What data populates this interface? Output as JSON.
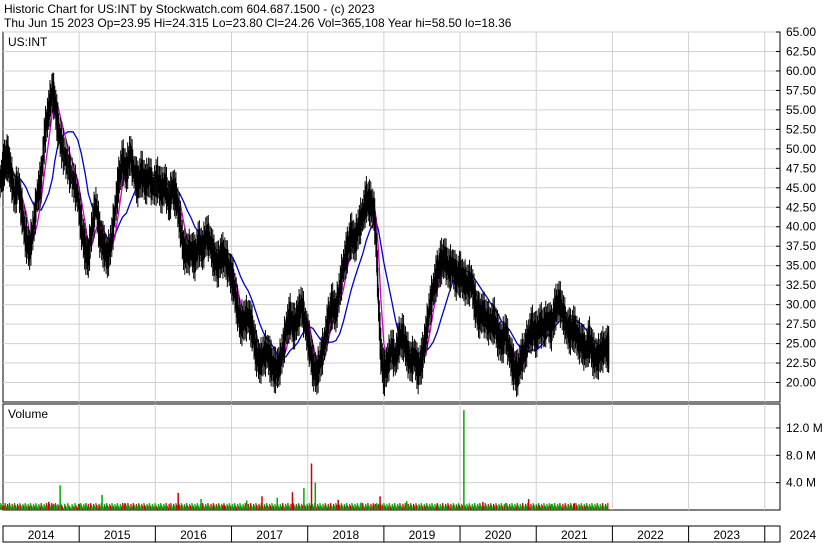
{
  "header": {
    "line1": "Historic Chart for US:INT by Stockwatch.com 604.687.1500 - (c) 2023",
    "line2": "Thu Jun 15 2023   Op=23.95   Hi=24.315   Lo=23.80   Cl=24.26   Vol=365,108   Year hi=58.50   lo=18.36"
  },
  "chart_data": {
    "type": "line",
    "symbol_label": "US:INT",
    "volume_label": "Volume",
    "x_ticks": [
      "2014",
      "2015",
      "2016",
      "2017",
      "2018",
      "2019",
      "2020",
      "2021",
      "2022",
      "2023",
      "2024"
    ],
    "x_range": [
      2014,
      2024.2
    ],
    "price_ticks": [
      "65.00",
      "62.50",
      "60.00",
      "57.50",
      "55.00",
      "52.50",
      "50.00",
      "47.50",
      "45.00",
      "42.50",
      "40.00",
      "37.50",
      "35.00",
      "32.50",
      "30.00",
      "27.50",
      "25.00",
      "22.50",
      "20.00"
    ],
    "price_range": [
      17.5,
      65.0
    ],
    "volume_ticks": [
      "12.0 M",
      "8.0 M",
      "4.0 M"
    ],
    "volume_range": [
      0,
      15.5
    ],
    "grid": true,
    "colors": {
      "price": "#000000",
      "ma_short": "#cc00cc",
      "ma_long": "#0000cc",
      "volume_up": "#00aa00",
      "volume_down": "#cc0000"
    },
    "price_series": [
      {
        "x": 2013.93,
        "y": 44.5
      },
      {
        "x": 2013.98,
        "y": 46.5
      },
      {
        "x": 2014.02,
        "y": 48.2
      },
      {
        "x": 2014.06,
        "y": 49.0
      },
      {
        "x": 2014.1,
        "y": 47.0
      },
      {
        "x": 2014.15,
        "y": 44.0
      },
      {
        "x": 2014.2,
        "y": 45.5
      },
      {
        "x": 2014.25,
        "y": 42.0
      },
      {
        "x": 2014.3,
        "y": 38.5
      },
      {
        "x": 2014.35,
        "y": 37.0
      },
      {
        "x": 2014.4,
        "y": 40.0
      },
      {
        "x": 2014.45,
        "y": 44.0
      },
      {
        "x": 2014.5,
        "y": 46.0
      },
      {
        "x": 2014.55,
        "y": 52.0
      },
      {
        "x": 2014.6,
        "y": 55.0
      },
      {
        "x": 2014.65,
        "y": 57.5
      },
      {
        "x": 2014.68,
        "y": 56.0
      },
      {
        "x": 2014.72,
        "y": 53.0
      },
      {
        "x": 2014.78,
        "y": 50.0
      },
      {
        "x": 2014.85,
        "y": 48.0
      },
      {
        "x": 2014.92,
        "y": 46.0
      },
      {
        "x": 2014.98,
        "y": 44.0
      },
      {
        "x": 2015.03,
        "y": 40.0
      },
      {
        "x": 2015.08,
        "y": 37.0
      },
      {
        "x": 2015.12,
        "y": 36.0
      },
      {
        "x": 2015.17,
        "y": 40.0
      },
      {
        "x": 2015.22,
        "y": 43.0
      },
      {
        "x": 2015.27,
        "y": 39.0
      },
      {
        "x": 2015.32,
        "y": 37.5
      },
      {
        "x": 2015.37,
        "y": 36.0
      },
      {
        "x": 2015.42,
        "y": 38.0
      },
      {
        "x": 2015.47,
        "y": 42.0
      },
      {
        "x": 2015.52,
        "y": 46.0
      },
      {
        "x": 2015.57,
        "y": 48.5
      },
      {
        "x": 2015.62,
        "y": 47.0
      },
      {
        "x": 2015.67,
        "y": 49.5
      },
      {
        "x": 2015.72,
        "y": 47.0
      },
      {
        "x": 2015.77,
        "y": 45.5
      },
      {
        "x": 2015.82,
        "y": 47.0
      },
      {
        "x": 2015.87,
        "y": 45.5
      },
      {
        "x": 2015.92,
        "y": 46.5
      },
      {
        "x": 2015.97,
        "y": 45.0
      },
      {
        "x": 2016.03,
        "y": 46.0
      },
      {
        "x": 2016.08,
        "y": 44.5
      },
      {
        "x": 2016.13,
        "y": 45.5
      },
      {
        "x": 2016.18,
        "y": 43.0
      },
      {
        "x": 2016.22,
        "y": 45.0
      },
      {
        "x": 2016.27,
        "y": 44.0
      },
      {
        "x": 2016.32,
        "y": 41.0
      },
      {
        "x": 2016.37,
        "y": 37.0
      },
      {
        "x": 2016.42,
        "y": 36.5
      },
      {
        "x": 2016.47,
        "y": 37.0
      },
      {
        "x": 2016.52,
        "y": 36.0
      },
      {
        "x": 2016.57,
        "y": 38.0
      },
      {
        "x": 2016.62,
        "y": 37.0
      },
      {
        "x": 2016.67,
        "y": 39.0
      },
      {
        "x": 2016.72,
        "y": 38.0
      },
      {
        "x": 2016.77,
        "y": 36.0
      },
      {
        "x": 2016.82,
        "y": 35.0
      },
      {
        "x": 2016.87,
        "y": 36.5
      },
      {
        "x": 2016.92,
        "y": 36.0
      },
      {
        "x": 2016.97,
        "y": 34.5
      },
      {
        "x": 2017.02,
        "y": 33.0
      },
      {
        "x": 2017.07,
        "y": 30.0
      },
      {
        "x": 2017.12,
        "y": 27.5
      },
      {
        "x": 2017.17,
        "y": 28.0
      },
      {
        "x": 2017.22,
        "y": 28.5
      },
      {
        "x": 2017.27,
        "y": 27.0
      },
      {
        "x": 2017.32,
        "y": 24.0
      },
      {
        "x": 2017.37,
        "y": 22.5
      },
      {
        "x": 2017.42,
        "y": 23.5
      },
      {
        "x": 2017.47,
        "y": 24.0
      },
      {
        "x": 2017.52,
        "y": 22.5
      },
      {
        "x": 2017.57,
        "y": 21.5
      },
      {
        "x": 2017.62,
        "y": 22.0
      },
      {
        "x": 2017.67,
        "y": 24.0
      },
      {
        "x": 2017.72,
        "y": 27.0
      },
      {
        "x": 2017.77,
        "y": 28.5
      },
      {
        "x": 2017.82,
        "y": 27.0
      },
      {
        "x": 2017.87,
        "y": 28.5
      },
      {
        "x": 2017.92,
        "y": 30.0
      },
      {
        "x": 2017.97,
        "y": 27.5
      },
      {
        "x": 2018.02,
        "y": 25.0
      },
      {
        "x": 2018.07,
        "y": 22.0
      },
      {
        "x": 2018.12,
        "y": 21.0
      },
      {
        "x": 2018.17,
        "y": 23.0
      },
      {
        "x": 2018.22,
        "y": 25.0
      },
      {
        "x": 2018.27,
        "y": 28.0
      },
      {
        "x": 2018.32,
        "y": 30.0
      },
      {
        "x": 2018.37,
        "y": 29.0
      },
      {
        "x": 2018.42,
        "y": 32.0
      },
      {
        "x": 2018.47,
        "y": 35.0
      },
      {
        "x": 2018.52,
        "y": 37.0
      },
      {
        "x": 2018.57,
        "y": 39.0
      },
      {
        "x": 2018.62,
        "y": 38.0
      },
      {
        "x": 2018.67,
        "y": 40.0
      },
      {
        "x": 2018.72,
        "y": 41.5
      },
      {
        "x": 2018.77,
        "y": 43.5
      },
      {
        "x": 2018.82,
        "y": 43.0
      },
      {
        "x": 2018.87,
        "y": 42.0
      },
      {
        "x": 2018.9,
        "y": 38.0
      },
      {
        "x": 2018.93,
        "y": 30.0
      },
      {
        "x": 2018.96,
        "y": 24.0
      },
      {
        "x": 2019.0,
        "y": 21.0
      },
      {
        "x": 2019.05,
        "y": 22.5
      },
      {
        "x": 2019.1,
        "y": 24.5
      },
      {
        "x": 2019.15,
        "y": 23.0
      },
      {
        "x": 2019.2,
        "y": 25.5
      },
      {
        "x": 2019.25,
        "y": 26.0
      },
      {
        "x": 2019.3,
        "y": 24.0
      },
      {
        "x": 2019.35,
        "y": 22.5
      },
      {
        "x": 2019.4,
        "y": 23.5
      },
      {
        "x": 2019.45,
        "y": 21.5
      },
      {
        "x": 2019.5,
        "y": 23.0
      },
      {
        "x": 2019.55,
        "y": 26.0
      },
      {
        "x": 2019.6,
        "y": 29.5
      },
      {
        "x": 2019.65,
        "y": 32.0
      },
      {
        "x": 2019.7,
        "y": 34.0
      },
      {
        "x": 2019.75,
        "y": 35.5
      },
      {
        "x": 2019.8,
        "y": 36.0
      },
      {
        "x": 2019.85,
        "y": 34.5
      },
      {
        "x": 2019.9,
        "y": 35.0
      },
      {
        "x": 2019.95,
        "y": 33.5
      },
      {
        "x": 2020.0,
        "y": 34.0
      },
      {
        "x": 2020.05,
        "y": 33.0
      },
      {
        "x": 2020.1,
        "y": 32.5
      },
      {
        "x": 2020.15,
        "y": 33.0
      },
      {
        "x": 2020.2,
        "y": 30.0
      },
      {
        "x": 2020.25,
        "y": 28.5
      },
      {
        "x": 2020.3,
        "y": 29.0
      },
      {
        "x": 2020.35,
        "y": 28.0
      },
      {
        "x": 2020.4,
        "y": 27.5
      },
      {
        "x": 2020.45,
        "y": 28.0
      },
      {
        "x": 2020.5,
        "y": 26.0
      },
      {
        "x": 2020.55,
        "y": 25.0
      },
      {
        "x": 2020.6,
        "y": 26.5
      },
      {
        "x": 2020.65,
        "y": 24.0
      },
      {
        "x": 2020.7,
        "y": 22.0
      },
      {
        "x": 2020.75,
        "y": 21.0
      },
      {
        "x": 2020.8,
        "y": 23.0
      },
      {
        "x": 2020.85,
        "y": 24.0
      },
      {
        "x": 2020.9,
        "y": 26.0
      },
      {
        "x": 2020.95,
        "y": 27.0
      },
      {
        "x": 2021.0,
        "y": 26.0
      },
      {
        "x": 2021.05,
        "y": 27.5
      },
      {
        "x": 2021.1,
        "y": 27.0
      },
      {
        "x": 2021.15,
        "y": 28.0
      },
      {
        "x": 2021.2,
        "y": 27.0
      },
      {
        "x": 2021.25,
        "y": 29.5
      },
      {
        "x": 2021.3,
        "y": 30.5
      },
      {
        "x": 2021.35,
        "y": 29.0
      },
      {
        "x": 2021.4,
        "y": 27.0
      },
      {
        "x": 2021.45,
        "y": 26.5
      },
      {
        "x": 2021.5,
        "y": 27.0
      },
      {
        "x": 2021.55,
        "y": 25.5
      },
      {
        "x": 2021.6,
        "y": 25.0
      },
      {
        "x": 2021.65,
        "y": 24.0
      },
      {
        "x": 2021.7,
        "y": 25.5
      },
      {
        "x": 2021.75,
        "y": 23.5
      },
      {
        "x": 2021.8,
        "y": 23.0
      },
      {
        "x": 2021.85,
        "y": 24.0
      },
      {
        "x": 2021.9,
        "y": 24.5
      },
      {
        "x": 2021.95,
        "y": 24.26
      }
    ],
    "volume_series": [
      {
        "x": 2014.0,
        "v": 0.6
      },
      {
        "x": 2014.3,
        "v": 0.8
      },
      {
        "x": 2014.6,
        "v": 1.2
      },
      {
        "x": 2014.75,
        "v": 3.6
      },
      {
        "x": 2015.0,
        "v": 0.9
      },
      {
        "x": 2015.3,
        "v": 2.2
      },
      {
        "x": 2015.6,
        "v": 1.0
      },
      {
        "x": 2016.0,
        "v": 0.7
      },
      {
        "x": 2016.3,
        "v": 2.5
      },
      {
        "x": 2016.6,
        "v": 1.6
      },
      {
        "x": 2016.9,
        "v": 0.8
      },
      {
        "x": 2017.2,
        "v": 1.4
      },
      {
        "x": 2017.4,
        "v": 2.0
      },
      {
        "x": 2017.6,
        "v": 1.8
      },
      {
        "x": 2017.8,
        "v": 2.6
      },
      {
        "x": 2017.95,
        "v": 3.2
      },
      {
        "x": 2018.05,
        "v": 6.8
      },
      {
        "x": 2018.1,
        "v": 4.0
      },
      {
        "x": 2018.4,
        "v": 1.5
      },
      {
        "x": 2018.7,
        "v": 1.1
      },
      {
        "x": 2018.95,
        "v": 2.0
      },
      {
        "x": 2019.3,
        "v": 1.3
      },
      {
        "x": 2019.7,
        "v": 0.9
      },
      {
        "x": 2020.05,
        "v": 14.6
      },
      {
        "x": 2020.3,
        "v": 1.2
      },
      {
        "x": 2020.6,
        "v": 1.0
      },
      {
        "x": 2020.9,
        "v": 1.6
      },
      {
        "x": 2021.2,
        "v": 0.9
      },
      {
        "x": 2021.5,
        "v": 1.0
      },
      {
        "x": 2021.8,
        "v": 0.7
      }
    ]
  }
}
